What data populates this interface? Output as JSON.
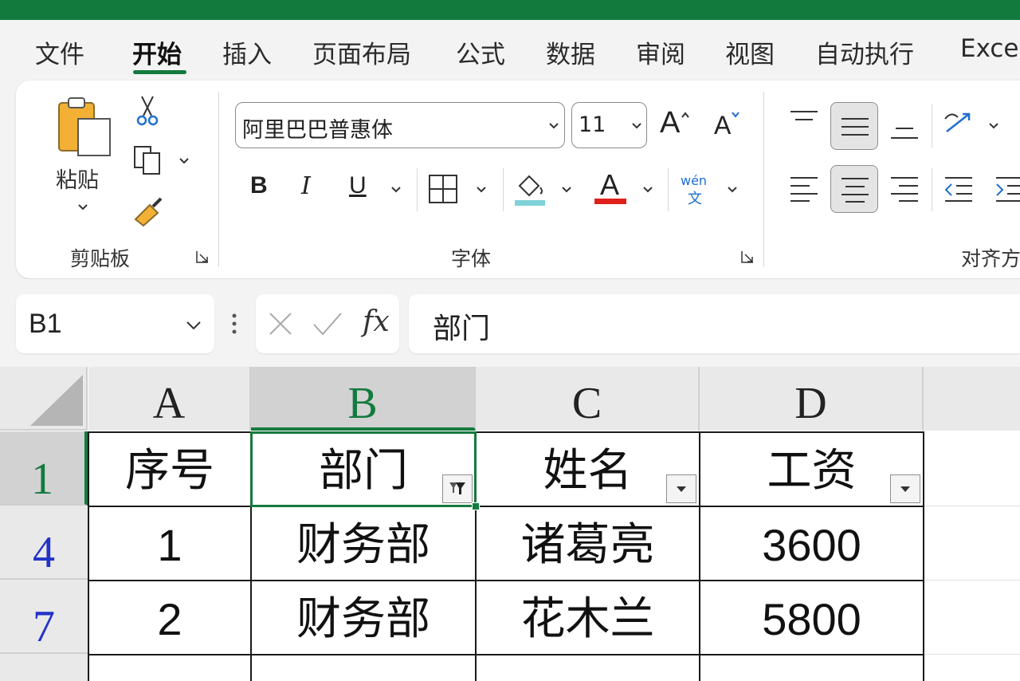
{
  "menu": {
    "tabs": [
      {
        "label": "文件",
        "active": false
      },
      {
        "label": "开始",
        "active": true
      },
      {
        "label": "插入",
        "active": false
      },
      {
        "label": "页面布局",
        "active": false
      },
      {
        "label": "公式",
        "active": false
      },
      {
        "label": "数据",
        "active": false
      },
      {
        "label": "审阅",
        "active": false
      },
      {
        "label": "视图",
        "active": false
      },
      {
        "label": "自动执行",
        "active": false
      },
      {
        "label": "Exce",
        "active": false
      }
    ]
  },
  "ribbon": {
    "clipboard": {
      "paste_label": "粘贴",
      "group_label": "剪贴板"
    },
    "font": {
      "font_name": "阿里巴巴普惠体",
      "font_size": "11",
      "bold_label": "B",
      "italic_label": "I",
      "underline_label": "U",
      "grow_label": "A",
      "shrink_label": "A",
      "font_color_label": "A",
      "phonetic_top": "wén",
      "phonetic_bottom": "文",
      "group_label": "字体",
      "fill_color": "#7fd3d8",
      "font_color": "#e0201c"
    },
    "alignment": {
      "group_label": "对齐方"
    }
  },
  "formula_bar": {
    "name_box": "B1",
    "fx_label": "fx",
    "content": "部门"
  },
  "sheet": {
    "columns": [
      "A",
      "B",
      "C",
      "D"
    ],
    "selected_column": "B",
    "rows": [
      {
        "row_num": "1",
        "cells": [
          "序号",
          "部门",
          "姓名",
          "工资"
        ]
      },
      {
        "row_num": "4",
        "cells": [
          "1",
          "财务部",
          "诸葛亮",
          "3600"
        ]
      },
      {
        "row_num": "7",
        "cells": [
          "2",
          "财务部",
          "花木兰",
          "5800"
        ]
      }
    ],
    "active_cell": "B1",
    "filtered_column": "B"
  },
  "colors": {
    "accent": "#137a3e",
    "row_number": "#2233c8"
  }
}
